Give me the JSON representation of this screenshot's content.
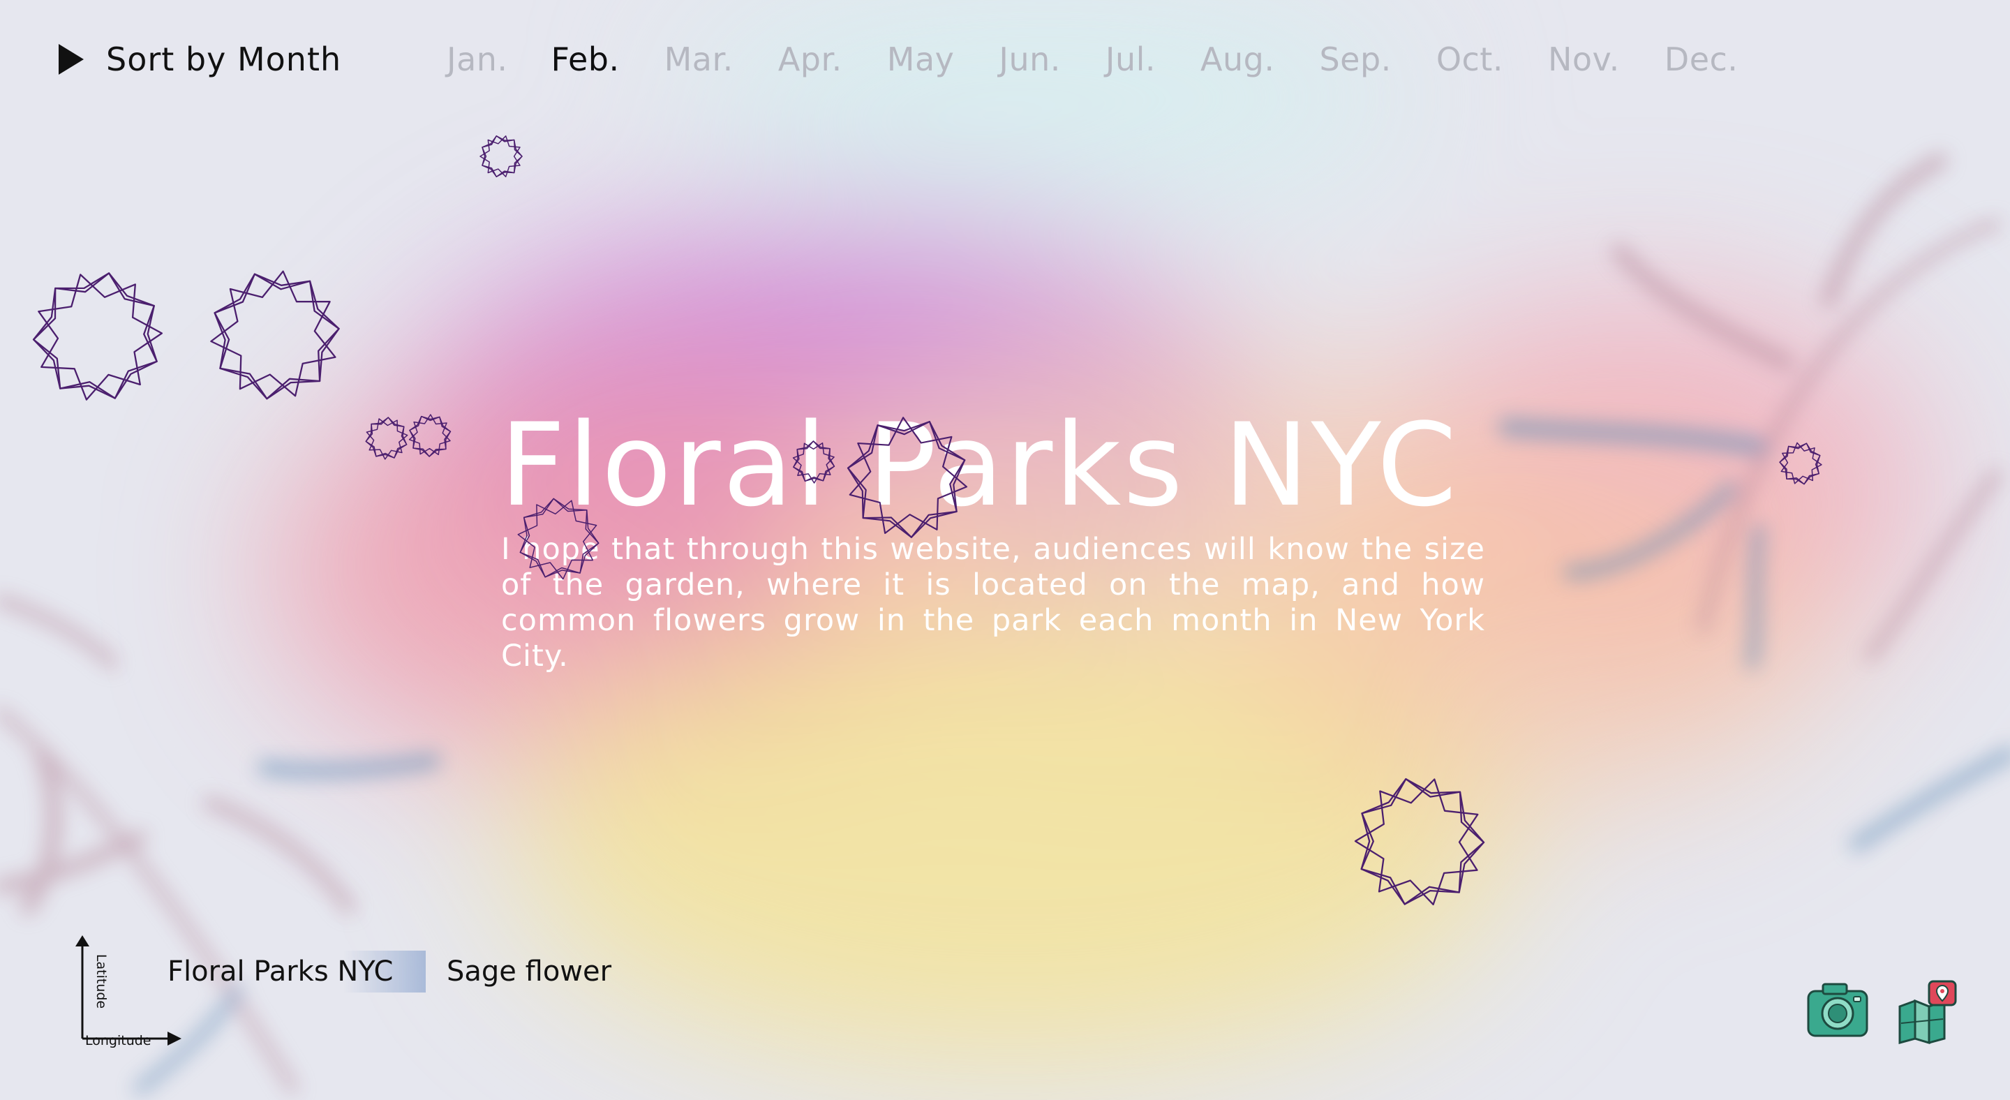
{
  "sort": {
    "label": "Sort by Month",
    "icon": "play-icon"
  },
  "months": [
    {
      "label": "Jan.",
      "active": false
    },
    {
      "label": "Feb.",
      "active": true
    },
    {
      "label": "Mar.",
      "active": false
    },
    {
      "label": "Apr.",
      "active": false
    },
    {
      "label": "May",
      "active": false
    },
    {
      "label": "Jun.",
      "active": false
    },
    {
      "label": "Jul.",
      "active": false
    },
    {
      "label": "Aug.",
      "active": false
    },
    {
      "label": "Sep.",
      "active": false
    },
    {
      "label": "Oct.",
      "active": false
    },
    {
      "label": "Nov.",
      "active": false
    },
    {
      "label": "Dec.",
      "active": false
    }
  ],
  "hero": {
    "title": "Floral Parks NYC",
    "description": "I hope that through this website, audiences will know the size of the garden, where it is located on the map, and how common flowers grow in the park each month in New York City."
  },
  "tabs": {
    "floral_parks": "Floral Parks NYC",
    "sage_flower": "Sage flower"
  },
  "axes": {
    "y_label": "Latitude",
    "x_label": "Longitude"
  },
  "icons": {
    "camera": "camera-icon",
    "map": "map-pin-icon",
    "flower": "flower-outline-icon"
  },
  "colors": {
    "active_month": "#0e0e10",
    "inactive_month": "#b6b8c1",
    "flower_stroke": "#4b1f6e",
    "blob_magenta": "#cf7fd3",
    "blob_pink": "#f09aa8",
    "blob_yellow": "#f3e39a",
    "camera_teal": "#3aa98e",
    "map_red": "#e0485a"
  }
}
